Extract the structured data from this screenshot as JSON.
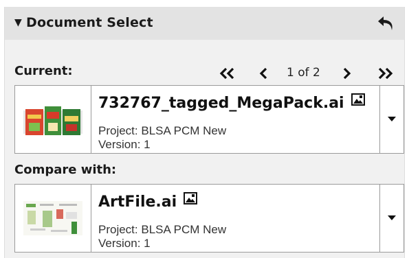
{
  "header": {
    "title": "Document Select"
  },
  "current": {
    "label": "Current:",
    "page_indicator": "1 of 2",
    "document": {
      "name": "732767_tagged_MegaPack.ai",
      "project": "Project: BLSA PCM New",
      "version": "Version: 1"
    }
  },
  "compare": {
    "label": "Compare with:",
    "document": {
      "name": "ArtFile.ai",
      "project": "Project: BLSA PCM New",
      "version": "Version: 1"
    }
  },
  "icons": {
    "collapse": "triangle-down-icon",
    "undo": "undo-arrow-icon",
    "first": "double-chevron-left-icon",
    "prev": "chevron-left-icon",
    "next": "chevron-right-icon",
    "last": "double-chevron-right-icon",
    "image_type": "image-file-icon",
    "dropdown": "caret-down-icon"
  },
  "colors": {
    "header_bg": "#e3e3e3",
    "panel_bg": "#f1f1f1",
    "card_border": "#9a9a9a"
  }
}
